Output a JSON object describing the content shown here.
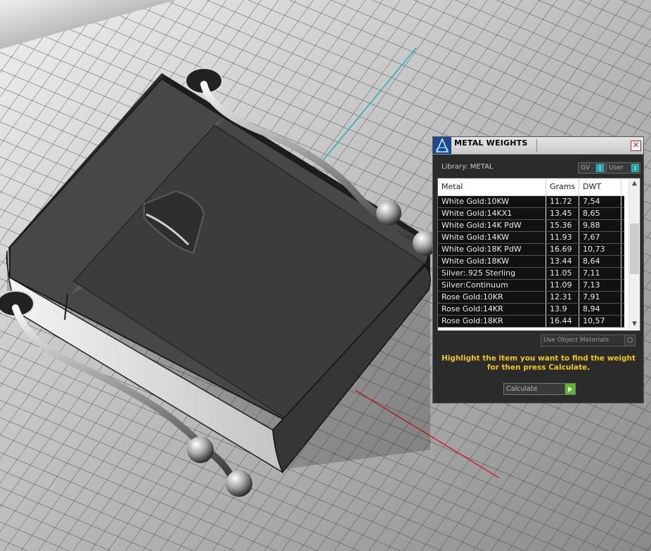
{
  "panel": {
    "title": "METAL WEIGHTS",
    "close_glyph": "✕",
    "library_label": "Library: METAL",
    "gv_toggle": "GV",
    "user_toggle": "User"
  },
  "list": {
    "headers": {
      "metal": "Metal",
      "grams": "Grams",
      "dwt": "DWT"
    },
    "rows": [
      {
        "metal": "White Gold:10KW",
        "grams": "11.72",
        "dwt": "7,54"
      },
      {
        "metal": "White Gold:14KX1",
        "grams": "13.45",
        "dwt": "8,65"
      },
      {
        "metal": "White Gold:14K PdW",
        "grams": "15.36",
        "dwt": "9,88"
      },
      {
        "metal": "White Gold:14KW",
        "grams": "11.93",
        "dwt": "7,67"
      },
      {
        "metal": "White Gold:18K PdW",
        "grams": "16.69",
        "dwt": "10,73"
      },
      {
        "metal": "White Gold:18KW",
        "grams": "13.44",
        "dwt": "8,64"
      },
      {
        "metal": "Silver:.925 Sterling",
        "grams": "11.05",
        "dwt": "7,11"
      },
      {
        "metal": "Silver:Continuum",
        "grams": "11.09",
        "dwt": "7,13"
      },
      {
        "metal": "Rose Gold:10KR",
        "grams": "12.31",
        "dwt": "7,91"
      },
      {
        "metal": "Rose Gold:14KR",
        "grams": "13.9",
        "dwt": "8,94"
      },
      {
        "metal": "Rose Gold:18KR",
        "grams": "16.44",
        "dwt": "10,57"
      }
    ]
  },
  "use_object_materials": "Use Object Materials",
  "hint": "Highlight the item you want to find the weight for then press Calculate.",
  "calculate": "Calculate",
  "colors": {
    "hint_text": "#f0c419",
    "toggle_accent": "#2ba6b0",
    "calculate_accent": "#5cb832",
    "y_axis": "#1fb3b3",
    "x_axis": "#d42020"
  }
}
